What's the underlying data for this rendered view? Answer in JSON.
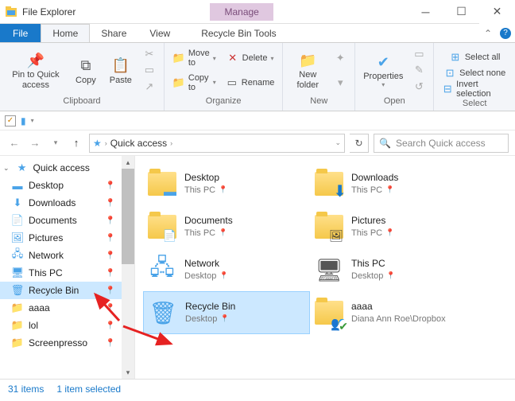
{
  "window": {
    "title": "File Explorer",
    "context_tab": "Manage",
    "context_sub": "Recycle Bin Tools"
  },
  "tabs": {
    "file": "File",
    "home": "Home",
    "share": "Share",
    "view": "View"
  },
  "ribbon": {
    "clipboard": {
      "label": "Clipboard",
      "pin": "Pin to Quick access",
      "copy": "Copy",
      "paste": "Paste"
    },
    "organize": {
      "label": "Organize",
      "move_to": "Move to",
      "copy_to": "Copy to",
      "delete": "Delete",
      "rename": "Rename"
    },
    "new": {
      "label": "New",
      "new_folder": "New folder"
    },
    "open": {
      "label": "Open",
      "properties": "Properties"
    },
    "select": {
      "label": "Select",
      "select_all": "Select all",
      "select_none": "Select none",
      "invert": "Invert selection"
    }
  },
  "breadcrumb": {
    "root": "Quick access"
  },
  "search": {
    "placeholder": "Search Quick access"
  },
  "sidebar": {
    "header": "Quick access",
    "items": [
      {
        "label": "Desktop",
        "pinned": true
      },
      {
        "label": "Downloads",
        "pinned": true
      },
      {
        "label": "Documents",
        "pinned": true
      },
      {
        "label": "Pictures",
        "pinned": true
      },
      {
        "label": "Network",
        "pinned": true
      },
      {
        "label": "This PC",
        "pinned": true
      },
      {
        "label": "Recycle Bin",
        "pinned": true
      },
      {
        "label": "aaaa",
        "pinned": true
      },
      {
        "label": "lol",
        "pinned": true
      },
      {
        "label": "Screenpresso",
        "pinned": true
      }
    ]
  },
  "items": [
    {
      "name": "Desktop",
      "sub": "This PC"
    },
    {
      "name": "Downloads",
      "sub": "This PC"
    },
    {
      "name": "Documents",
      "sub": "This PC"
    },
    {
      "name": "Pictures",
      "sub": "This PC"
    },
    {
      "name": "Network",
      "sub": "Desktop"
    },
    {
      "name": "This PC",
      "sub": "Desktop"
    },
    {
      "name": "Recycle Bin",
      "sub": "Desktop"
    },
    {
      "name": "aaaa",
      "sub": "Diana Ann Roe\\Dropbox"
    }
  ],
  "status": {
    "count": "31 items",
    "selected": "1 item selected"
  }
}
